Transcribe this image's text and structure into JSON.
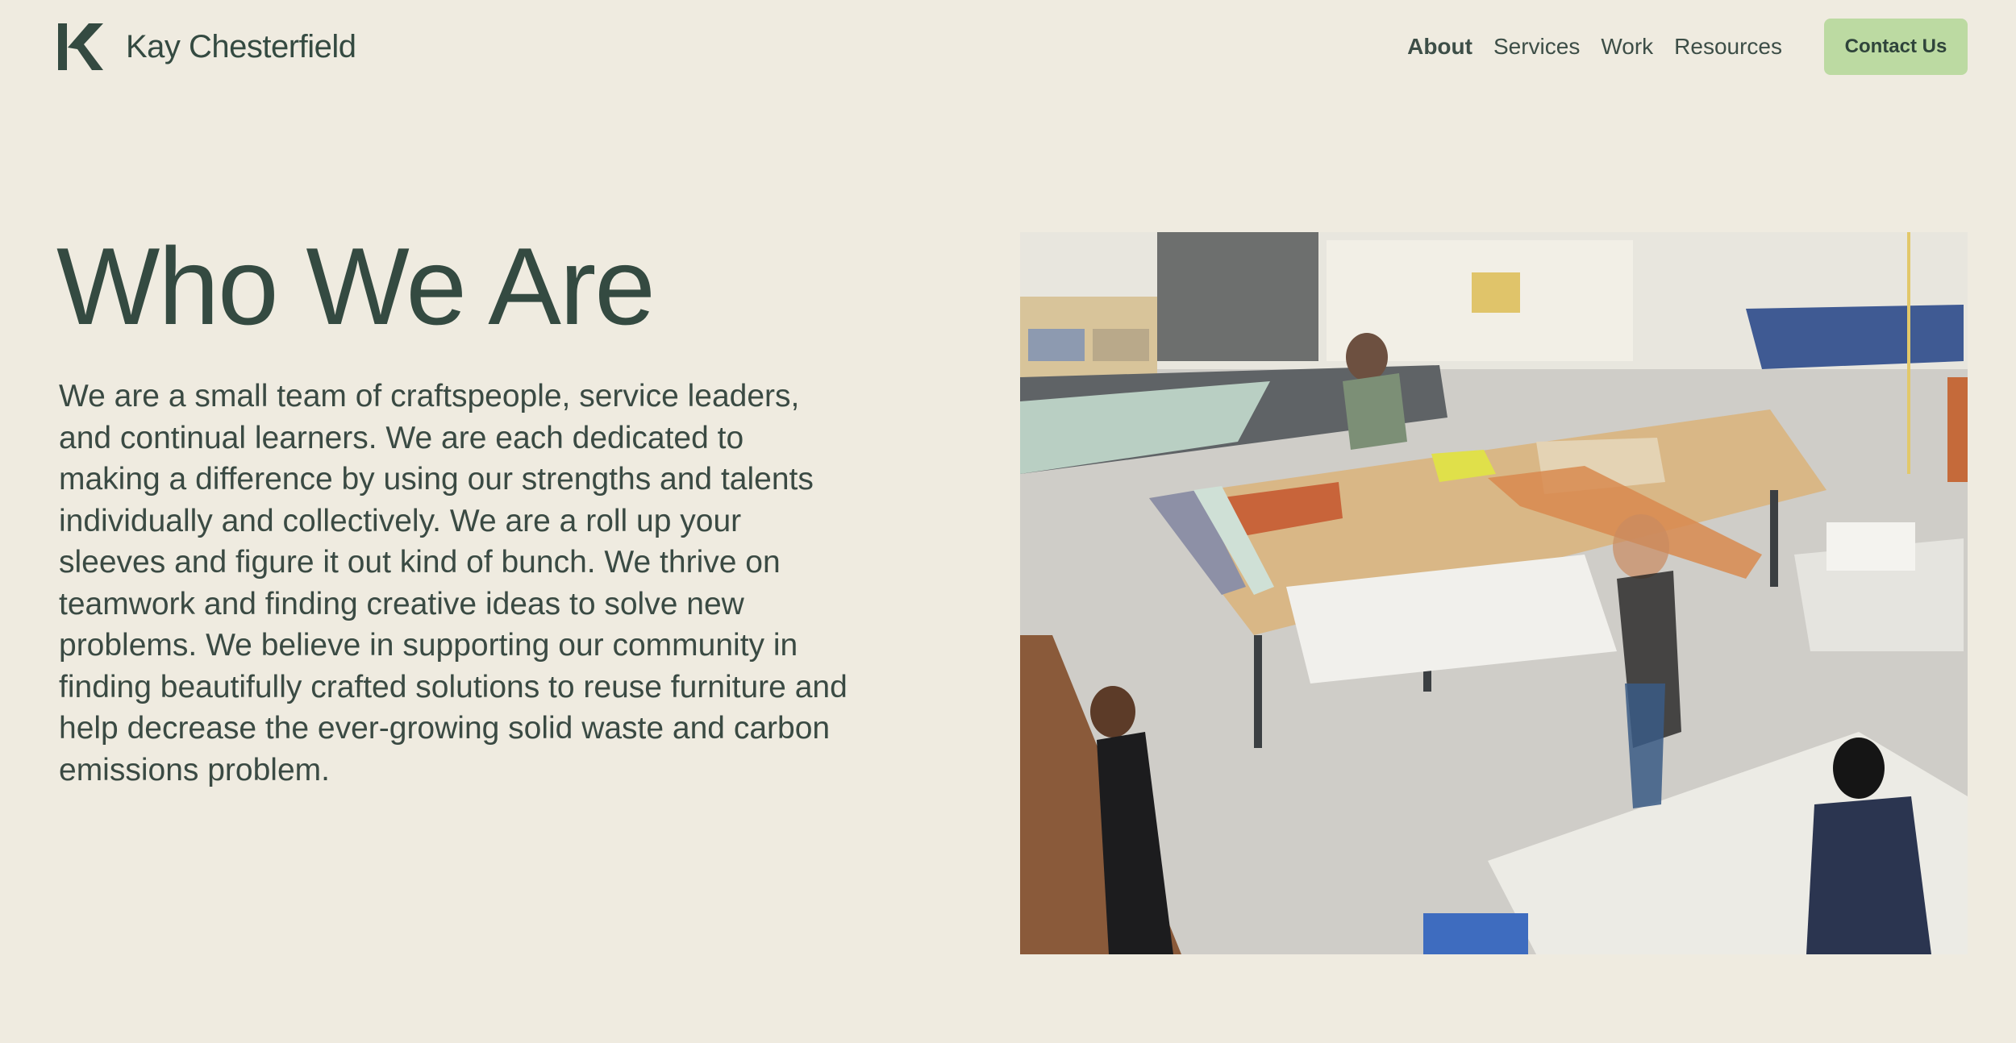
{
  "header": {
    "brand_name": "Kay Chesterfield",
    "logo_icon": "kc-monogram-icon",
    "nav": [
      {
        "label": "About",
        "active": true
      },
      {
        "label": "Services",
        "active": false
      },
      {
        "label": "Work",
        "active": false
      },
      {
        "label": "Resources",
        "active": false
      }
    ],
    "contact_label": "Contact Us"
  },
  "hero": {
    "title": "Who We Are",
    "body": "We are a small team of craftspeople, service leaders, and continual learners. We are each dedicated to making a difference by using our strengths and talents individually and collectively. We are a roll up your sleeves and figure it out kind of bunch. We thrive on teamwork and finding creative ideas to solve new problems. We believe in supporting our community in finding beautifully crafted solutions to reuse furniture and help decrease the ever-growing solid waste and carbon emissions problem.",
    "image_subject": "upholstery workshop"
  },
  "colors": {
    "background": "#efebe0",
    "text": "#344a41",
    "accent": "#bcdaa2"
  }
}
